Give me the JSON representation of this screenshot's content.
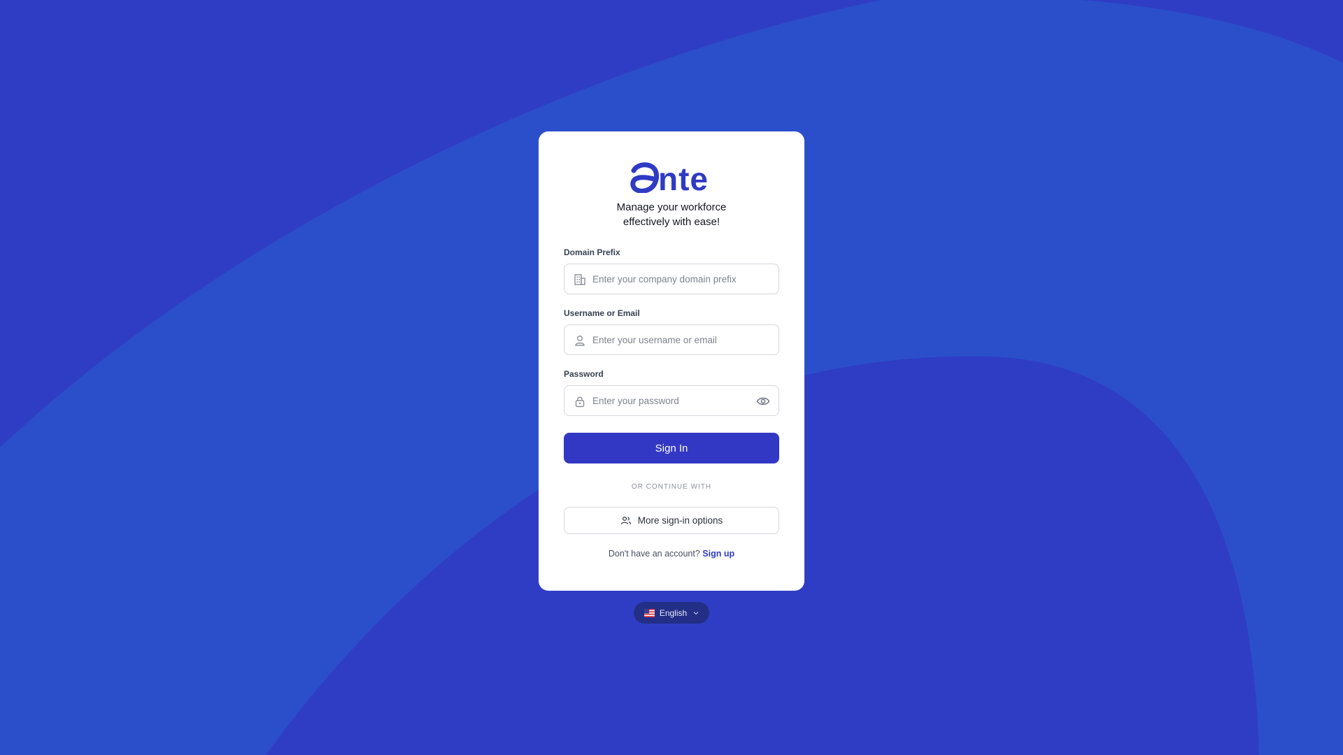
{
  "colors": {
    "background": "#2f3dc5",
    "background_wave": "#2b4fca",
    "brand": "#2f3bc4",
    "card": "#ffffff",
    "primary_button": "#3338c4",
    "language_pill": "#232f86"
  },
  "brand": {
    "logo_text": "ante",
    "logo_icon": "ante-logo"
  },
  "card": {
    "tagline_line1": "Manage your workforce",
    "tagline_line2": "effectively with ease!"
  },
  "form": {
    "domain": {
      "label": "Domain Prefix",
      "placeholder": "Enter your company domain prefix",
      "value": "",
      "icon": "building-icon"
    },
    "username": {
      "label": "Username or Email",
      "placeholder": "Enter your username or email",
      "value": "",
      "icon": "user-icon"
    },
    "password": {
      "label": "Password",
      "placeholder": "Enter your password",
      "value": "",
      "icon": "lock-icon",
      "toggle_icon": "eye-icon"
    },
    "submit_label": "Sign In"
  },
  "alt_login": {
    "divider_text": "OR CONTINUE WITH",
    "more_options_label": "More sign-in options",
    "more_options_icon": "users-icon"
  },
  "signup": {
    "prompt": "Don't have an account?",
    "link_label": "Sign up"
  },
  "language": {
    "selected": "English",
    "flag_icon": "us-flag-icon",
    "chevron_icon": "chevron-down-icon"
  }
}
